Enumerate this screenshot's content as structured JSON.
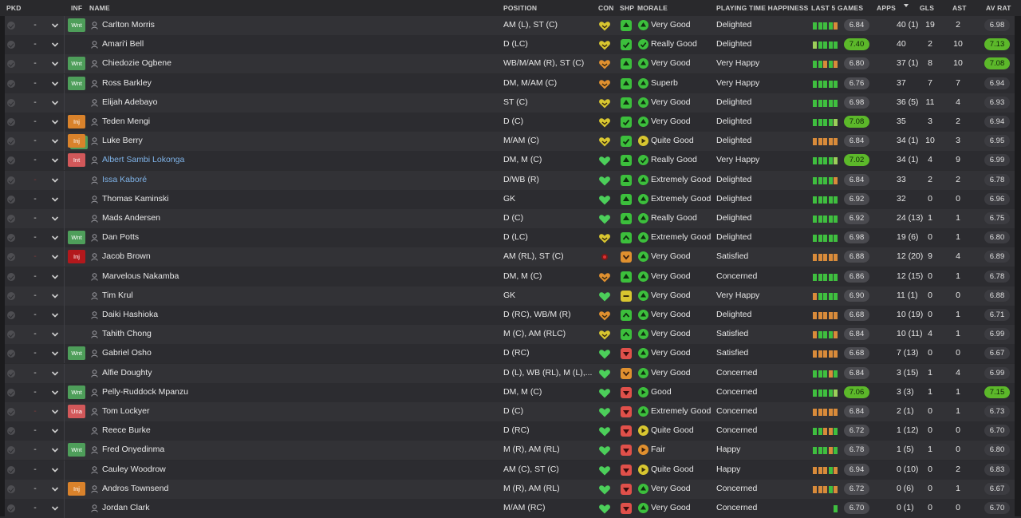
{
  "columns": {
    "pkd": "PKD",
    "inf": "INF",
    "name": "NAME",
    "position": "POSITION",
    "con": "CON",
    "shp": "SHP",
    "morale": "MORALE",
    "pth": "PLAYING TIME HAPPINESS",
    "last5": "LAST 5 GAMES",
    "apps": "APPS",
    "gls": "GLS",
    "ast": "AST",
    "avrat": "AV RAT"
  },
  "colors": {
    "bar_green": "#3fbf3f",
    "bar_orange": "#d98b3a",
    "bar_light": "#9ccf5a",
    "heart_green": "#4ccf5a",
    "heart_yellow": "#d8c630",
    "heart_orange": "#e0902f",
    "highlight": "#5cb82a",
    "inf_wnt": "#4e9e5a",
    "inf_inj": "#d9822b",
    "inf_int": "#d2585a"
  },
  "players": [
    {
      "pkd": "-",
      "inf": "Wnt",
      "name": "Carlton Morris",
      "position": "AM (L), ST (C)",
      "con": "heart-yellow",
      "shp": "up-green",
      "morale_icon": "up-green",
      "morale": "Very Good",
      "pth": "Delighted",
      "bars": "ggggo",
      "last5": "6.84",
      "last5_hi": false,
      "apps": "40 (1)",
      "gls": "19",
      "ast": "2",
      "avrat": "6.98",
      "avrat_hi": false
    },
    {
      "pkd": "-",
      "inf": "",
      "name": "Amari'i Bell",
      "position": "D (LC)",
      "con": "heart-yellow",
      "shp": "check-green",
      "morale_icon": "check-green",
      "morale": "Really Good",
      "pth": "Delighted",
      "bars": "lgggg",
      "last5": "7.40",
      "last5_hi": true,
      "apps": "40",
      "gls": "2",
      "ast": "10",
      "avrat": "7.13",
      "avrat_hi": true
    },
    {
      "pkd": "-",
      "inf": "Wnt",
      "name": "Chiedozie Ogbene",
      "position": "WB/M/AM (R), ST (C)",
      "con": "heart-orange",
      "shp": "up-green",
      "morale_icon": "up-green",
      "morale": "Very Good",
      "pth": "Very Happy",
      "bars": "ggogo",
      "last5": "6.80",
      "last5_hi": false,
      "apps": "37 (1)",
      "gls": "8",
      "ast": "10",
      "avrat": "7.08",
      "avrat_hi": true
    },
    {
      "pkd": "-",
      "inf": "Wnt",
      "name": "Ross Barkley",
      "position": "DM, M/AM (C)",
      "con": "heart-orange",
      "shp": "up-green",
      "morale_icon": "up-green",
      "morale": "Superb",
      "pth": "Very Happy",
      "bars": "ggggg",
      "last5": "6.76",
      "last5_hi": false,
      "apps": "37",
      "gls": "7",
      "ast": "7",
      "avrat": "6.94",
      "avrat_hi": false
    },
    {
      "pkd": "-",
      "inf": "",
      "name": "Elijah Adebayo",
      "position": "ST (C)",
      "con": "heart-yellow",
      "shp": "up-green",
      "morale_icon": "up-green",
      "morale": "Very Good",
      "pth": "Delighted",
      "bars": "ggggg",
      "last5": "6.98",
      "last5_hi": false,
      "apps": "36 (5)",
      "gls": "11",
      "ast": "4",
      "avrat": "6.93",
      "avrat_hi": false
    },
    {
      "pkd": "-",
      "inf": "Inj",
      "name": "Teden Mengi",
      "position": "D (C)",
      "con": "heart-yellow",
      "shp": "check-green",
      "morale_icon": "up-green",
      "morale": "Very Good",
      "pth": "Delighted",
      "bars": "ggggl",
      "last5": "7.08",
      "last5_hi": true,
      "apps": "35",
      "gls": "3",
      "ast": "2",
      "avrat": "6.94",
      "avrat_hi": false
    },
    {
      "pkd": "-",
      "inf": "Inj",
      "inf_stack": true,
      "name": "Luke Berry",
      "position": "M/AM (C)",
      "con": "heart-yellow",
      "shp": "check-green",
      "morale_icon": "right-yellow",
      "morale": "Quite Good",
      "pth": "Delighted",
      "bars": "ooooo",
      "last5": "6.84",
      "last5_hi": false,
      "apps": "34 (1)",
      "gls": "10",
      "ast": "3",
      "avrat": "6.95",
      "avrat_hi": false
    },
    {
      "pkd": "-",
      "inf": "Int",
      "name": "Albert Sambi Lokonga",
      "name_link": true,
      "position": "DM, M (C)",
      "con": "heart-green",
      "shp": "up-green",
      "morale_icon": "check-green",
      "morale": "Really Good",
      "pth": "Very Happy",
      "bars": "ggggl",
      "last5": "7.02",
      "last5_hi": true,
      "apps": "34 (1)",
      "gls": "4",
      "ast": "9",
      "avrat": "6.99",
      "avrat_hi": false
    },
    {
      "pkd": "",
      "inf": "",
      "name": "Issa Kaboré",
      "name_link": true,
      "position": "D/WB (R)",
      "con": "heart-green",
      "shp": "up-green",
      "morale_icon": "up-green",
      "morale": "Extremely Good",
      "pth": "Delighted",
      "bars": "ggggo",
      "last5": "6.84",
      "last5_hi": false,
      "apps": "33",
      "gls": "2",
      "ast": "2",
      "avrat": "6.78",
      "avrat_hi": false
    },
    {
      "pkd": "-",
      "inf": "",
      "name": "Thomas Kaminski",
      "position": "GK",
      "con": "heart-green",
      "shp": "up-green",
      "morale_icon": "up-green",
      "morale": "Extremely Good",
      "pth": "Delighted",
      "bars": "ggggg",
      "last5": "6.92",
      "last5_hi": false,
      "apps": "32",
      "gls": "0",
      "ast": "0",
      "avrat": "6.96",
      "avrat_hi": false
    },
    {
      "pkd": "-",
      "inf": "",
      "name": "Mads Andersen",
      "position": "D (C)",
      "con": "heart-green",
      "shp": "up-green",
      "morale_icon": "up-green",
      "morale": "Really Good",
      "pth": "Delighted",
      "bars": "ggggg",
      "last5": "6.92",
      "last5_hi": false,
      "apps": "24 (13)",
      "gls": "1",
      "ast": "1",
      "avrat": "6.75",
      "avrat_hi": false
    },
    {
      "pkd": "-",
      "inf": "Wnt",
      "name": "Dan Potts",
      "position": "D (LC)",
      "con": "heart-yellow",
      "shp": "up2-green",
      "morale_icon": "up-green",
      "morale": "Extremely Good",
      "pth": "Delighted",
      "bars": "ggggg",
      "last5": "6.98",
      "last5_hi": false,
      "apps": "19 (6)",
      "gls": "0",
      "ast": "1",
      "avrat": "6.80",
      "avrat_hi": false
    },
    {
      "pkd": "",
      "inf": "Inj",
      "inf_dark": true,
      "name": "Jacob Brown",
      "position": "AM (RL), ST (C)",
      "con": "dot-red",
      "shp": "down-orange",
      "morale_icon": "up-green",
      "morale": "Very Good",
      "pth": "Satisfied",
      "bars": "ooooo",
      "last5": "6.88",
      "last5_hi": false,
      "apps": "12 (20)",
      "gls": "9",
      "ast": "4",
      "avrat": "6.89",
      "avrat_hi": false
    },
    {
      "pkd": "-",
      "inf": "",
      "name": "Marvelous Nakamba",
      "position": "DM, M (C)",
      "con": "heart-orange",
      "shp": "up-green",
      "morale_icon": "up-green",
      "morale": "Very Good",
      "pth": "Concerned",
      "bars": "ggggg",
      "last5": "6.86",
      "last5_hi": false,
      "apps": "12 (15)",
      "gls": "0",
      "ast": "1",
      "avrat": "6.78",
      "avrat_hi": false
    },
    {
      "pkd": "-",
      "inf": "",
      "name": "Tim Krul",
      "position": "GK",
      "con": "heart-green",
      "shp": "flat-yellow",
      "morale_icon": "up-green",
      "morale": "Very Good",
      "pth": "Very Happy",
      "bars": "ogggg",
      "last5": "6.90",
      "last5_hi": false,
      "apps": "11 (1)",
      "gls": "0",
      "ast": "0",
      "avrat": "6.88",
      "avrat_hi": false
    },
    {
      "pkd": "-",
      "inf": "",
      "name": "Daiki Hashioka",
      "position": "D (RC), WB/M (R)",
      "con": "heart-orange",
      "shp": "up2-green",
      "morale_icon": "up-green",
      "morale": "Very Good",
      "pth": "Delighted",
      "bars": "ooooo",
      "last5": "6.68",
      "last5_hi": false,
      "apps": "10 (19)",
      "gls": "0",
      "ast": "1",
      "avrat": "6.71",
      "avrat_hi": false
    },
    {
      "pkd": "-",
      "inf": "",
      "name": "Tahith Chong",
      "position": "M (C), AM (RLC)",
      "con": "heart-yellow",
      "shp": "up2-green",
      "morale_icon": "up-green",
      "morale": "Very Good",
      "pth": "Satisfied",
      "bars": "ogggo",
      "last5": "6.84",
      "last5_hi": false,
      "apps": "10 (11)",
      "gls": "4",
      "ast": "1",
      "avrat": "6.99",
      "avrat_hi": false
    },
    {
      "pkd": "-",
      "inf": "Wnt",
      "name": "Gabriel Osho",
      "position": "D (RC)",
      "con": "heart-green",
      "shp": "down-red",
      "morale_icon": "up-green",
      "morale": "Very Good",
      "pth": "Satisfied",
      "bars": "ooooo",
      "last5": "6.68",
      "last5_hi": false,
      "apps": "7 (13)",
      "gls": "0",
      "ast": "0",
      "avrat": "6.67",
      "avrat_hi": false
    },
    {
      "pkd": "-",
      "inf": "",
      "name": "Alfie Doughty",
      "position": "D (L), WB (RL), M (L),...",
      "con": "heart-green",
      "shp": "down-orange",
      "morale_icon": "up-green",
      "morale": "Very Good",
      "pth": "Concerned",
      "bars": "gggog",
      "last5": "6.84",
      "last5_hi": false,
      "apps": "3 (15)",
      "gls": "1",
      "ast": "4",
      "avrat": "6.99",
      "avrat_hi": false
    },
    {
      "pkd": "-",
      "inf": "Wnt",
      "name": "Pelly-Ruddock Mpanzu",
      "position": "DM, M (C)",
      "con": "heart-green",
      "shp": "down-red",
      "morale_icon": "right-green",
      "morale": "Good",
      "pth": "Concerned",
      "bars": "ggggl",
      "last5": "7.06",
      "last5_hi": true,
      "apps": "3 (3)",
      "gls": "1",
      "ast": "1",
      "avrat": "7.15",
      "avrat_hi": true
    },
    {
      "pkd": "",
      "inf": "Una",
      "name": "Tom Lockyer",
      "position": "D (C)",
      "con": "heart-green",
      "shp": "down-red",
      "morale_icon": "up-green",
      "morale": "Extremely Good",
      "pth": "Concerned",
      "bars": "ooooo",
      "last5": "6.84",
      "last5_hi": false,
      "apps": "2 (1)",
      "gls": "0",
      "ast": "1",
      "avrat": "6.73",
      "avrat_hi": false
    },
    {
      "pkd": "-",
      "inf": "",
      "name": "Reece Burke",
      "position": "D (RC)",
      "con": "heart-green",
      "shp": "down-red",
      "morale_icon": "right-yellow",
      "morale": "Quite Good",
      "pth": "Concerned",
      "bars": "ggoog",
      "last5": "6.72",
      "last5_hi": false,
      "apps": "1 (12)",
      "gls": "0",
      "ast": "0",
      "avrat": "6.70",
      "avrat_hi": false
    },
    {
      "pkd": "-",
      "inf": "Wnt",
      "name": "Fred Onyedinma",
      "position": "M (R), AM (RL)",
      "con": "heart-green",
      "shp": "down-red",
      "morale_icon": "right-orange",
      "morale": "Fair",
      "pth": "Happy",
      "bars": "gggog",
      "last5": "6.78",
      "last5_hi": false,
      "apps": "1 (5)",
      "gls": "1",
      "ast": "0",
      "avrat": "6.80",
      "avrat_hi": false
    },
    {
      "pkd": "-",
      "inf": "",
      "name": "Cauley Woodrow",
      "position": "AM (C), ST (C)",
      "con": "heart-green",
      "shp": "down-red",
      "morale_icon": "right-yellow",
      "morale": "Quite Good",
      "pth": "Happy",
      "bars": "ooogo",
      "last5": "6.94",
      "last5_hi": false,
      "apps": "0 (10)",
      "gls": "0",
      "ast": "2",
      "avrat": "6.83",
      "avrat_hi": false
    },
    {
      "pkd": "-",
      "inf": "Inj",
      "name": "Andros Townsend",
      "position": "M (R), AM (RL)",
      "con": "heart-green",
      "shp": "down-red",
      "morale_icon": "up-green",
      "morale": "Very Good",
      "pth": "Concerned",
      "bars": "ooogo",
      "last5": "6.72",
      "last5_hi": false,
      "apps": "0 (6)",
      "gls": "0",
      "ast": "1",
      "avrat": "6.67",
      "avrat_hi": false
    },
    {
      "pkd": "-",
      "inf": "",
      "name": "Jordan Clark",
      "position": "M/AM (RC)",
      "con": "heart-green",
      "shp": "down-red",
      "morale_icon": "up-green",
      "morale": "Very Good",
      "pth": "Concerned",
      "bars": "____g",
      "last5": "6.70",
      "last5_hi": false,
      "apps": "0 (1)",
      "gls": "0",
      "ast": "0",
      "avrat": "6.70",
      "avrat_hi": false
    }
  ]
}
